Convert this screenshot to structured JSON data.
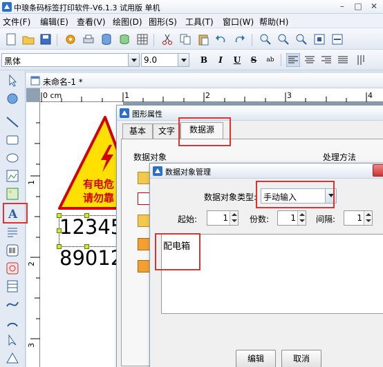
{
  "window": {
    "title": "中琅条码标签打印软件-V6.1.3 试用版 单机",
    "controls": [
      "–",
      "□",
      "✕"
    ]
  },
  "menu": {
    "items": [
      "文件(F)",
      "编辑(E)",
      "查看(V)",
      "绘图(D)",
      "图形(S)",
      "工具(T)",
      "窗口(W)",
      "帮助(H)"
    ]
  },
  "toolbar": {
    "icons": [
      "new-icon",
      "open-icon",
      "save-icon",
      "settings-icon",
      "print-icon",
      "database-icon",
      "database-config-icon",
      "grid-icon",
      "cut-icon",
      "copy-icon",
      "paste-icon",
      "undo-icon",
      "redo-icon",
      "zoom-in-icon",
      "zoom-out-icon",
      "zoom-icon",
      "fit-page-icon",
      "fit-width-icon"
    ]
  },
  "format_bar": {
    "font_name": "黑体",
    "font_size": "9.0",
    "bold": "B",
    "italic": "I",
    "underline": "U",
    "strike": "S",
    "spacing": "ab"
  },
  "document": {
    "tab_title": "未命名-1 *",
    "ruler_h_labels": [
      "0 cm",
      "1",
      "2",
      "3",
      "4"
    ],
    "ruler_v_labels": [
      "1",
      "2",
      "3"
    ]
  },
  "canvas": {
    "warning_line1": "有电危",
    "warning_line2": "请勿靠",
    "barcode_text_line1": "12345",
    "barcode_text_line2": "89012",
    "warning_color": "#ffe000",
    "warning_text_color": "#d40000"
  },
  "shape_properties": {
    "title": "图形属性",
    "tabs": [
      "基本",
      "文字",
      "数据源"
    ],
    "active_tab": "数据源",
    "data_object_label": "数据对象",
    "processing_label": "处理方法"
  },
  "data_manager": {
    "title": "数据对象管理",
    "type_label": "数据对象类型:",
    "type_value": "手动输入",
    "start_label": "起始:",
    "start_value": "1",
    "copies_label": "份数:",
    "copies_value": "1",
    "interval_label": "间隔:",
    "interval_value": "1",
    "content": "配电箱",
    "edit_button": "编辑",
    "cancel_button": "取消"
  },
  "colors": {
    "accent": "#3c7fd8",
    "highlight": "#e03030",
    "menu_bg": "#eef2f8"
  }
}
